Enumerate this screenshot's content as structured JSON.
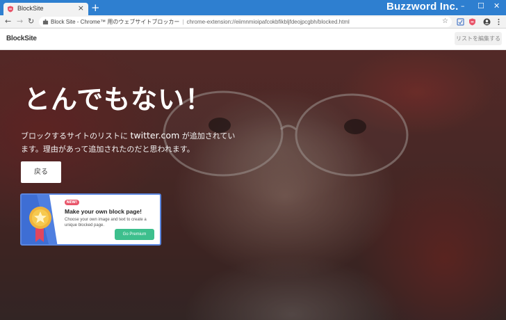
{
  "browser": {
    "tab_title": "BlockSite",
    "tab_close": "×",
    "new_tab": "+",
    "brand_watermark": "Buzzword Inc.",
    "window_controls": {
      "minimize": "–",
      "maximize": "☐",
      "close": "✕"
    },
    "nav": {
      "back": "←",
      "forward": "→",
      "reload": "↻"
    },
    "omnibox": {
      "page_title": "Block Site - Chrome™ 用のウェブサイトブロッカー",
      "separator": "|",
      "url": "chrome-extension://eiimnmioipafcokbfikbljfdeojpcgbh/blocked.html"
    },
    "bookmark_star": "☆"
  },
  "app": {
    "logo": "BlockSite",
    "edit_list_button": "リストを編集する"
  },
  "hero": {
    "title": "とんでもない！",
    "message_before": "ブロックするサイトのリストに",
    "blocked_site": "twitter.com",
    "message_after": "が追加されています。理由があって追加されたのだと思われます。",
    "back_button": "戻る"
  },
  "promo": {
    "badge": "NEW!",
    "title": "Make your own block page!",
    "description": "Choose your own image and text to create a unique blocked page.",
    "cta": "Go Premium"
  },
  "colors": {
    "titlebar": "#2e7fd0",
    "premium_green": "#3dbf8d",
    "new_badge": "#e8556a",
    "promo_border": "#5a86e0"
  }
}
